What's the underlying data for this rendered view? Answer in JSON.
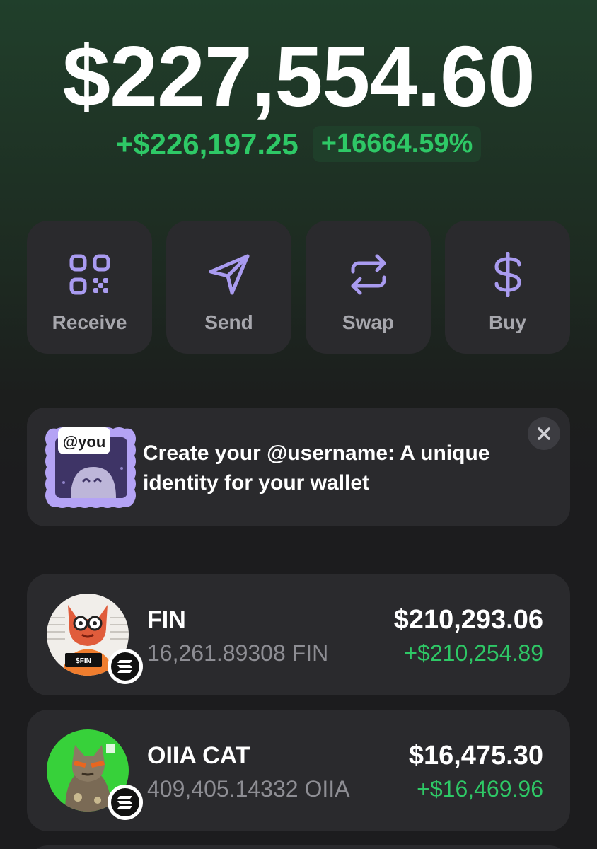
{
  "portfolio": {
    "balance": "$227,554.60",
    "change_amount": "+$226,197.25",
    "change_percent": "+16664.59%"
  },
  "actions": [
    {
      "label": "Receive",
      "icon": "qr-code-icon"
    },
    {
      "label": "Send",
      "icon": "send-icon"
    },
    {
      "label": "Swap",
      "icon": "swap-icon"
    },
    {
      "label": "Buy",
      "icon": "dollar-icon"
    }
  ],
  "banner": {
    "tag": "@you",
    "text": "Create your @username: A unique identity for your wallet",
    "close_icon": "close-icon"
  },
  "tokens": [
    {
      "name": "FIN",
      "amount": "16,261.89308 FIN",
      "value": "$210,293.06",
      "change": "+$210,254.89",
      "avatar_text": "$FIN",
      "chain_icon": "solana-icon"
    },
    {
      "name": "OIIA CAT",
      "amount": "409,405.14332 OIIA",
      "value": "$16,475.30",
      "change": "+$16,469.96",
      "chain_icon": "solana-icon"
    }
  ],
  "colors": {
    "accent_purple": "#a99bf0",
    "positive_green": "#2ec866",
    "card_bg": "#2a2a2d"
  }
}
